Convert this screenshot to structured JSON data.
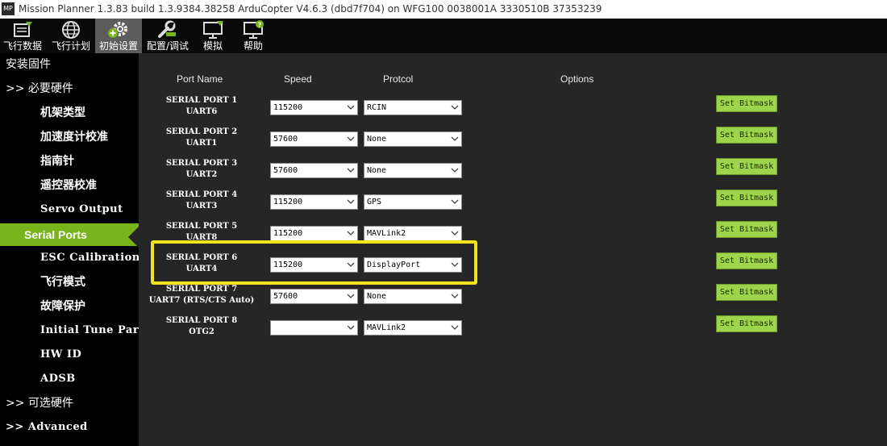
{
  "window": {
    "title": "Mission Planner 1.3.83 build 1.3.9384.38258 ArduCopter V4.6.3 (dbd7f704) on WFG100 0038001A 3330510B 37353239",
    "app_icon_text": "MP"
  },
  "toolbar": {
    "items": [
      {
        "label": "飞行数据",
        "icon": "flight-data-icon"
      },
      {
        "label": "飞行计划",
        "icon": "globe-icon"
      },
      {
        "label": "初始设置",
        "icon": "gear-add-icon"
      },
      {
        "label": "配置/调试",
        "icon": "wrench-icon"
      },
      {
        "label": "模拟",
        "icon": "monitor-icon"
      },
      {
        "label": "帮助",
        "icon": "help-monitor-icon"
      }
    ],
    "active_index": 2
  },
  "sidebar": {
    "items": [
      {
        "label": "安装固件"
      },
      {
        "label": ">> 必要硬件"
      },
      {
        "label": "机架类型"
      },
      {
        "label": "加速度计校准"
      },
      {
        "label": "指南针"
      },
      {
        "label": "遥控器校准"
      },
      {
        "label": "Servo Output"
      },
      {
        "label": "Serial Ports"
      },
      {
        "label": "ESC Calibration"
      },
      {
        "label": "飞行模式"
      },
      {
        "label": "故障保护"
      },
      {
        "label": "Initial Tune Parameters"
      },
      {
        "label": "HW ID"
      },
      {
        "label": "ADSB"
      },
      {
        "label": ">> 可选硬件"
      },
      {
        "label": ">> Advanced"
      }
    ],
    "active_label": "Serial Ports"
  },
  "table": {
    "headers": {
      "port_name": "Port Name",
      "speed": "Speed",
      "protocol": "Protcol",
      "options": "Options"
    },
    "rows": [
      {
        "name": "SERIAL PORT 1",
        "uart": "UART6",
        "speed": "115200",
        "protocol": "RCIN",
        "button": "Set Bitmask"
      },
      {
        "name": "SERIAL PORT 2",
        "uart": "UART1",
        "speed": "57600",
        "protocol": "None",
        "button": "Set Bitmask"
      },
      {
        "name": "SERIAL PORT 3",
        "uart": "UART2",
        "speed": "57600",
        "protocol": "None",
        "button": "Set Bitmask"
      },
      {
        "name": "SERIAL PORT 4",
        "uart": "UART3",
        "speed": "115200",
        "protocol": "GPS",
        "button": "Set Bitmask"
      },
      {
        "name": "SERIAL PORT 5",
        "uart": "UART8",
        "speed": "115200",
        "protocol": "MAVLink2",
        "button": "Set Bitmask"
      },
      {
        "name": "SERIAL PORT 6",
        "uart": "UART4",
        "speed": "115200",
        "protocol": "DisplayPort",
        "button": "Set Bitmask"
      },
      {
        "name": "SERIAL PORT 7",
        "uart": "UART7 (RTS/CTS Auto)",
        "speed": "57600",
        "protocol": "None",
        "button": "Set Bitmask"
      },
      {
        "name": "SERIAL PORT 8",
        "uart": "OTG2",
        "speed": "",
        "protocol": "MAVLink2",
        "button": "Set Bitmask"
      }
    ],
    "highlighted_row": "SERIAL PORT 6"
  },
  "colors": {
    "toolbar_bg": "#0a0a0a",
    "sidebar_bg": "#000000",
    "content_bg": "#262626",
    "active_green": "#7ab41d",
    "button_green": "#9ed44c",
    "highlight_yellow": "#f2e31f"
  }
}
